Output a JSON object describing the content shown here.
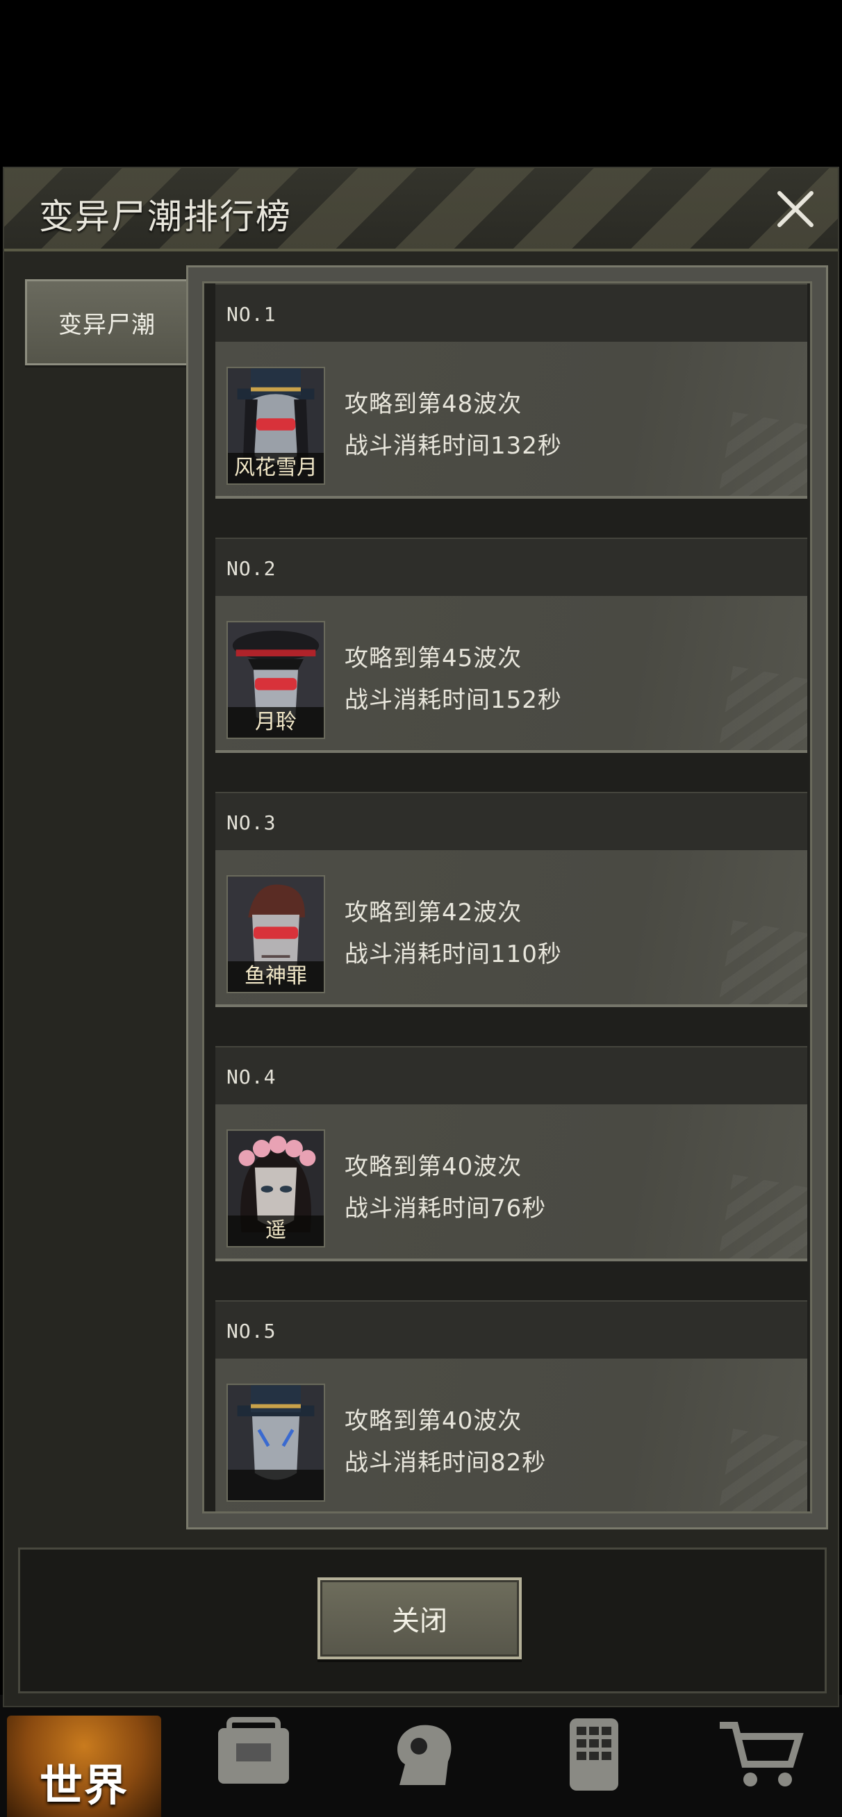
{
  "dialog": {
    "title": "变异尸潮排行榜",
    "close_button_label": "关闭"
  },
  "tabs": [
    {
      "label": "变异尸潮",
      "active": true
    }
  ],
  "rankings": [
    {
      "rank": "NO.1",
      "name": "风花雪月",
      "wave_text": "攻略到第48波次",
      "time_text": "战斗消耗时间132秒",
      "avatar": "top-hat-sunglasses"
    },
    {
      "rank": "NO.2",
      "name": "月聆",
      "wave_text": "攻略到第45波次",
      "time_text": "战斗消耗时间152秒",
      "avatar": "officer-cap-goggles"
    },
    {
      "rank": "NO.3",
      "name": "鱼神罪",
      "wave_text": "攻略到第42波次",
      "time_text": "战斗消耗时间110秒",
      "avatar": "pompadour-goggles"
    },
    {
      "rank": "NO.4",
      "name": "遥",
      "wave_text": "攻略到第40波次",
      "time_text": "战斗消耗时间76秒",
      "avatar": "flower-crown"
    },
    {
      "rank": "NO.5",
      "name": "",
      "wave_text": "攻略到第40波次",
      "time_text": "战斗消耗时间82秒",
      "avatar": "top-hat-facepaint"
    }
  ],
  "bottom_nav": {
    "items": [
      {
        "label": "世界",
        "icon": "globe-icon",
        "active": true
      },
      {
        "label": "",
        "icon": "backpack-icon"
      },
      {
        "label": "",
        "icon": "head-gear-icon"
      },
      {
        "label": "",
        "icon": "phone-icon"
      },
      {
        "label": "",
        "icon": "cart-icon"
      }
    ]
  },
  "colors": {
    "panel_bg": "#262621",
    "card_body": "#4d4d46",
    "text": "#e8e6dc",
    "nav_active": "#c97b1e"
  }
}
